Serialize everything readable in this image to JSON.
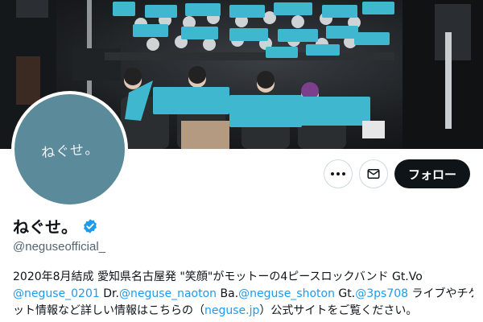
{
  "profile": {
    "display_name": "ねぐせ。",
    "handle": "@neguseofficial_",
    "avatar_text": "ねぐせ。",
    "verified": true
  },
  "actions": {
    "more_icon": "more-icon",
    "message_icon": "mail-icon",
    "follow_label": "フォロー"
  },
  "bio": {
    "line1": "2020年8月結成 愛知県名古屋発 \"笑顔\"がモットーの4ピースロックバンド Gt.Vo",
    "line2": {
      "link1": "@neguse_0201",
      "t1": " Dr.",
      "link2": "@neguse_naoton",
      "t2": " Ba.",
      "link3": "@neguse_shoton",
      "t3": " Gt.",
      "link4": "@3ps708",
      "t4": " ライブやチケ"
    },
    "line3": {
      "t1": "ット情報など詳しい情報はこちらの（",
      "link": "neguse.jp",
      "t2": "）公式サイトをご覧ください。"
    }
  },
  "colors": {
    "accent": "#1d9bf0",
    "avatar_bg": "#5b8a9a",
    "towel": "#3fb8cf",
    "follow_bg": "#0f1419"
  }
}
